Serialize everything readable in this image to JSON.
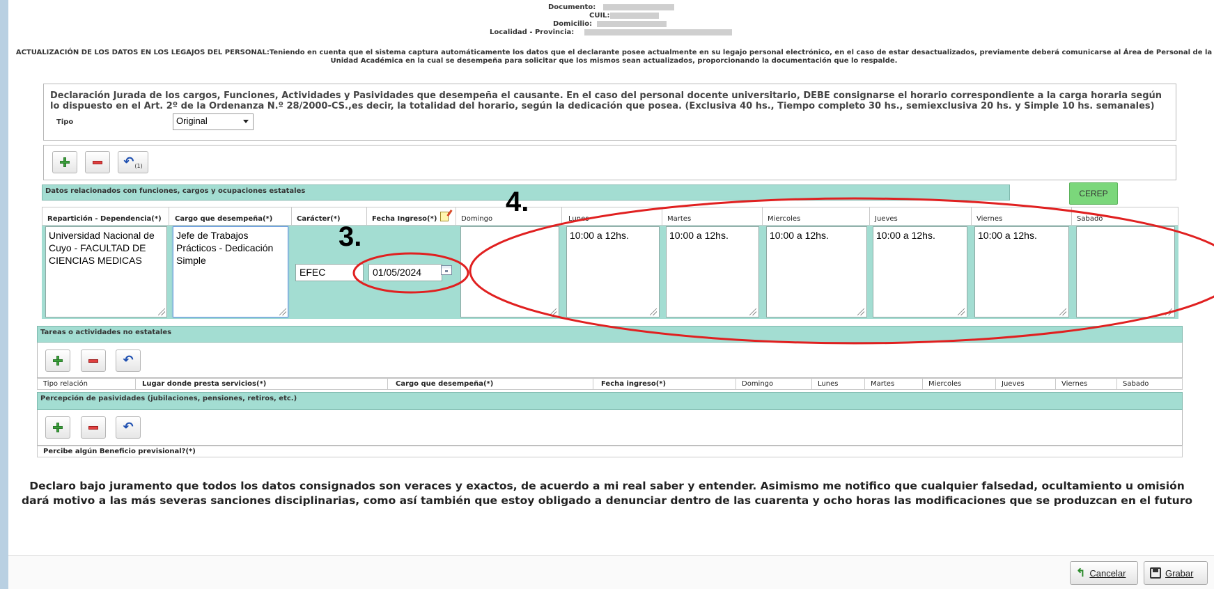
{
  "header": {
    "documento_label": "Documento:",
    "cuil_label": "CUIL:",
    "domicilio_label": "Domicilio:",
    "localidad_label": "Localidad - Provincia:",
    "notice": "ACTUALIZACIÓN DE LOS DATOS EN LOS LEGAJOS DEL PERSONAL:Teniendo en cuenta que el sistema captura automáticamente los datos que el declarante posee actualmente en su legajo personal electrónico, en el caso de estar desactualizados, previamente deberá comunicarse al Área de Personal de la Unidad Académica en la cual se desempeña para solicitar que los mismos sean actualizados, proporcionando la documentación que lo respalde."
  },
  "declaration": {
    "title": "Declaración Jurada de los cargos, Funciones, Actividades y Pasividades que desempeña el causante. En el caso del personal docente universitario, DEBE consignarse el horario correspondiente a la carga horaria según lo dispuesto en el Art. 2º de la Ordenanza N.º 28/2000-CS.,es decir, la totalidad del horario, según la dedicación que posea. (Exclusiva 40 hs., Tiempo completo 30 hs., semiexclusiva 20 hs. y Simple 10 hs. semanales)",
    "tipo_label": "Tipo",
    "tipo_value": "Original",
    "undo_count": "(1)"
  },
  "estatales": {
    "section_title": "Datos relacionados con funciones, cargos y ocupaciones estatales",
    "cerep_label": "CEREP",
    "columns": {
      "reparticion": "Repartición - Dependencia(*)",
      "cargo": "Cargo que desempeña(*)",
      "caracter": "Carácter(*)",
      "fecha": "Fecha Ingreso(*)",
      "domingo": "Domingo",
      "lunes": "Lunes",
      "martes": "Martes",
      "miercoles": "Miercoles",
      "jueves": "Jueves",
      "viernes": "Viernes",
      "sabado": "Sabado"
    },
    "row": {
      "reparticion": "Universidad Nacional de\nCuyo - FACULTAD DE\nCIENCIAS MEDICAS",
      "cargo": "Jefe de Trabajos\nPrácticos - Dedicación\nSimple",
      "caracter": "EFEC",
      "fecha": "01/05/2024",
      "domingo": "",
      "lunes": "10:00 a 12hs.",
      "martes": "10:00 a 12hs.",
      "miercoles": "10:00 a 12hs.",
      "jueves": "10:00 a 12hs.",
      "viernes": "10:00 a 12hs.",
      "sabado": ""
    }
  },
  "no_estatales": {
    "section_title": "Tareas o actividades no estatales",
    "columns": {
      "tipo": "Tipo relación",
      "lugar": "Lugar donde presta servicios(*)",
      "cargo": "Cargo que desempeña(*)",
      "fecha": "Fecha ingreso(*)",
      "domingo": "Domingo",
      "lunes": "Lunes",
      "martes": "Martes",
      "miercoles": "Miercoles",
      "jueves": "Jueves",
      "viernes": "Viernes",
      "sabado": "Sabado"
    }
  },
  "pasividades": {
    "section_title": "Percepción de pasividades (jubilaciones, pensiones, retiros, etc.)",
    "question": "Percibe algún Beneficio previsional?(*)"
  },
  "oath": {
    "line1": "Declaro bajo juramento que todos los datos consignados son veraces y exactos, de acuerdo a mi real saber y entender. Asimismo me notifico que cualquier falsedad, ocultamiento u omisión",
    "line2": "dará motivo a las más severas sanciones disciplinarias, como así también que estoy obligado a denunciar dentro de las cuarenta y ocho horas las modificaciones que se produzcan en el futuro"
  },
  "footer": {
    "cancel_label": "Cancelar",
    "save_label": "Grabar"
  },
  "annotations": {
    "step3": "3.",
    "step4": "4.",
    "color": "#e02020"
  }
}
